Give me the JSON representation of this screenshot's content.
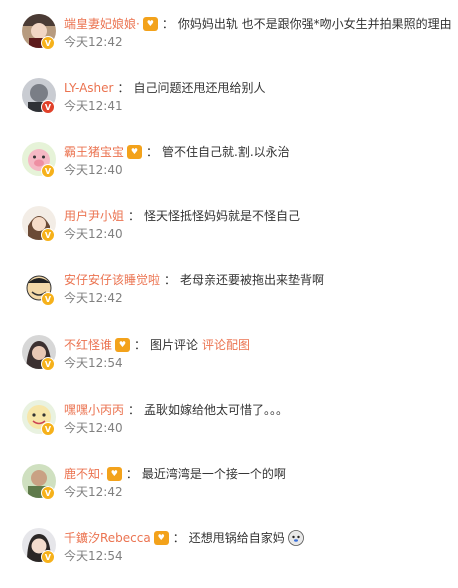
{
  "colors": {
    "username": "#eb7350",
    "comment_text": "#333333",
    "timestamp": "#808080",
    "badge_gold": "#f6b11a",
    "badge_red": "#e0412a",
    "medal": "#f3a21b"
  },
  "comments": [
    {
      "username": "端皇妻妃娘娘·",
      "separator": "：",
      "text": "你妈妈出轨 也不是跟你强*吻小女生并拍果照的理由",
      "time": "今天12:42",
      "badge_icon": "gold-v-badge-icon",
      "medal_icon": "fan-medal-icon"
    },
    {
      "username": "LY-Asher",
      "separator": "：",
      "text": "自己问题还甩还甩给别人",
      "time": "今天12:41",
      "badge_icon": "red-v-badge-icon"
    },
    {
      "username": "霸王猪宝宝",
      "separator": "：",
      "text": "管不住自己就.割.以永治",
      "time": "今天12:40",
      "badge_icon": "gold-v-badge-icon",
      "medal_icon": "fan-medal-icon"
    },
    {
      "username": "用户尹小姐",
      "separator": "：",
      "text": "怪天怪抵怪妈妈就是不怪自己",
      "time": "今天12:40",
      "badge_icon": "gold-v-badge-icon"
    },
    {
      "username": "安仔安仔该睡觉啦",
      "separator": "：",
      "text": "老母亲还要被拖出来垫背啊",
      "time": "今天12:42",
      "badge_icon": "gold-v-badge-icon"
    },
    {
      "username": "不红怪谁",
      "separator": "：",
      "text": "图片评论",
      "link": "评论配图",
      "time": "今天12:54",
      "badge_icon": "gold-v-badge-icon",
      "medal_icon": "fan-medal-icon"
    },
    {
      "username": "嘿嘿小丙丙",
      "separator": "：",
      "text": "孟耿如嫁给他太可惜了。。。",
      "time": "今天12:40",
      "badge_icon": "gold-v-badge-icon"
    },
    {
      "username": "鹿不知·",
      "separator": "：",
      "text": "最近湾湾是一个接一个的啊",
      "time": "今天12:42",
      "badge_icon": "gold-v-badge-icon",
      "medal_icon": "fan-medal-icon"
    },
    {
      "username": "千鑛汐Rebecca",
      "separator": "：",
      "text": "还想甩锅给自家妈",
      "time": "今天12:54",
      "badge_icon": "gold-v-badge-icon",
      "medal_icon": "fan-medal-icon",
      "emoji_icon": "doge-emoji-icon"
    }
  ]
}
